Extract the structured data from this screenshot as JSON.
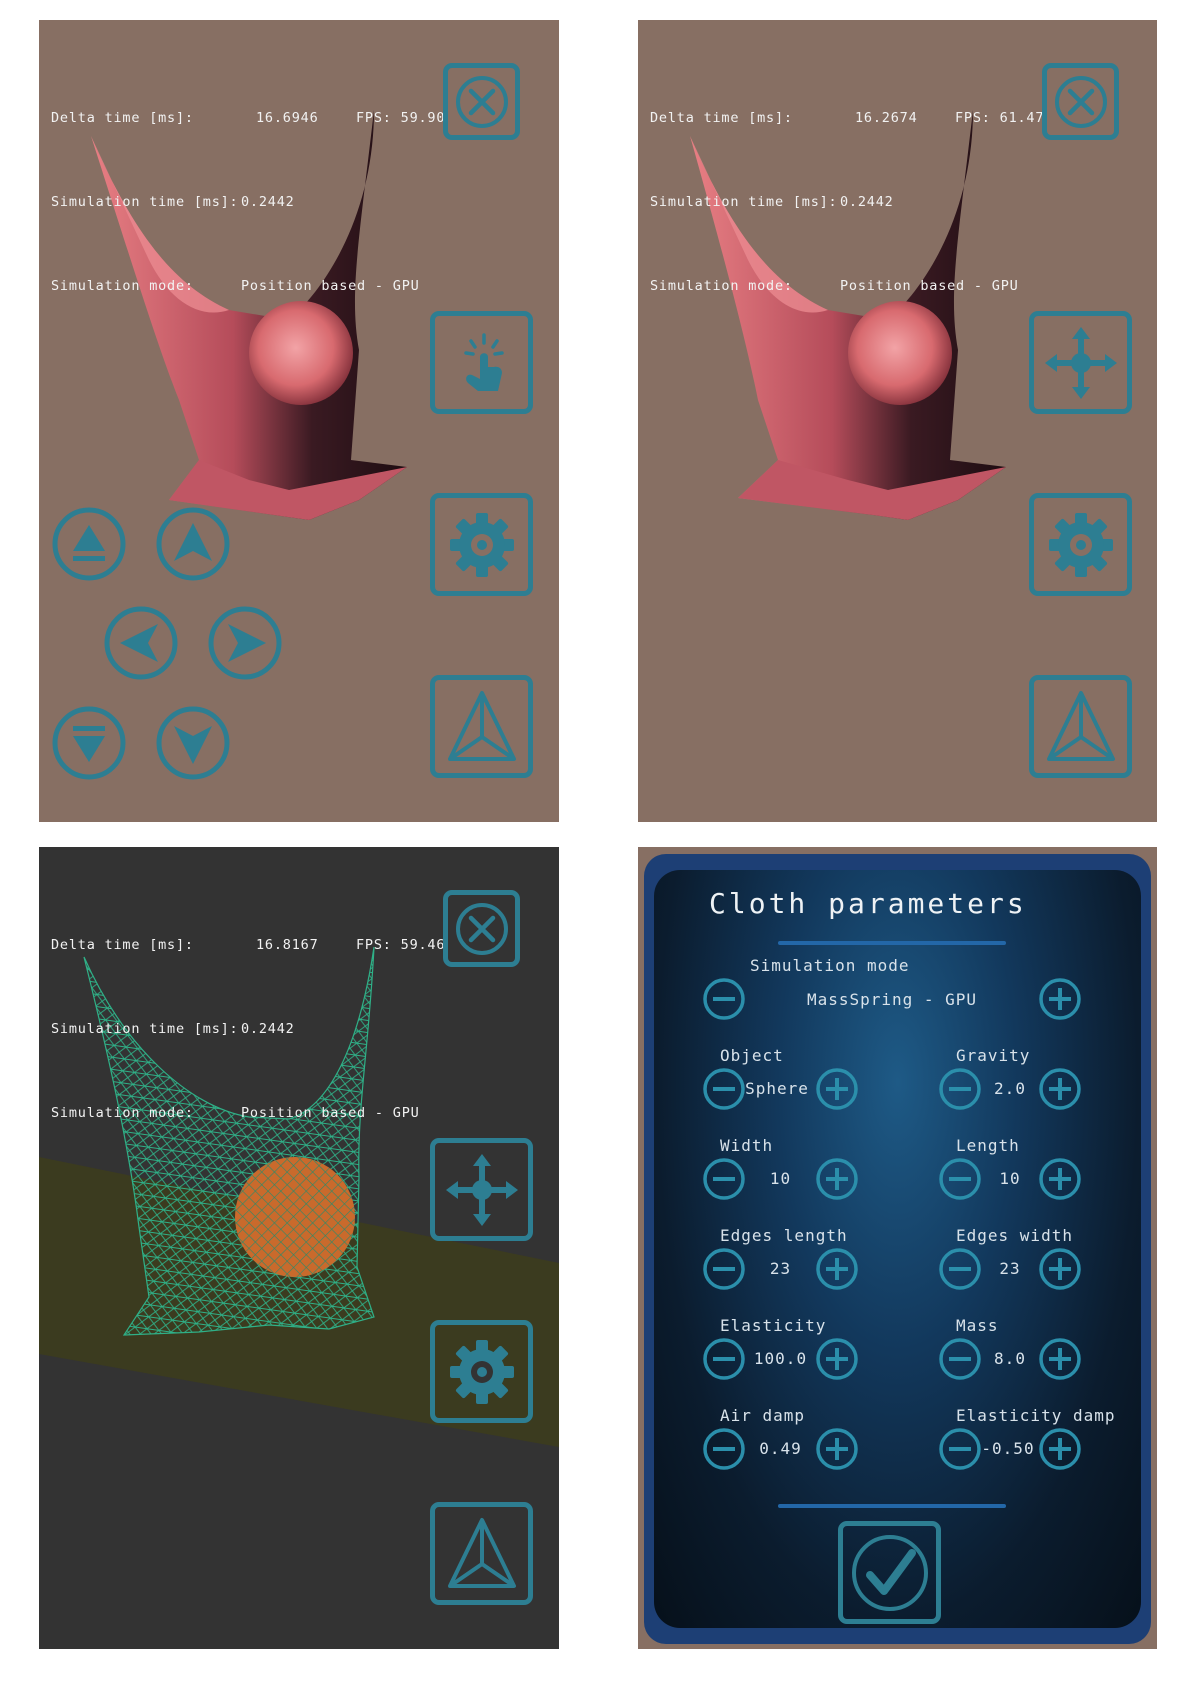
{
  "screens": [
    {
      "hud": {
        "delta_label": "Delta time [ms]:",
        "delta_value": "16.6946",
        "fps": "FPS: 59.90",
        "sim_time_label": "Simulation time [ms]:",
        "sim_time_value": "0.2442",
        "mode_label": "Simulation mode:",
        "mode_value": "Position based - GPU"
      },
      "render": "shaded",
      "buttons": [
        "close-icon",
        "touch-icon",
        "gear-icon",
        "wireframe-icon"
      ],
      "nav_pad": [
        "eject-up-icon",
        "arrow-up-icon",
        "arrow-left-icon",
        "arrow-right-icon",
        "eject-down-icon",
        "arrow-down-icon"
      ]
    },
    {
      "hud": {
        "delta_label": "Delta time [ms]:",
        "delta_value": "16.2674",
        "fps": "FPS: 61.47",
        "sim_time_label": "Simulation time [ms]:",
        "sim_time_value": "0.2442",
        "mode_label": "Simulation mode:",
        "mode_value": "Position based - GPU"
      },
      "render": "shaded",
      "buttons": [
        "close-icon",
        "move-icon",
        "gear-icon",
        "wireframe-icon"
      ]
    },
    {
      "hud": {
        "delta_label": "Delta time [ms]:",
        "delta_value": "16.8167",
        "fps": "FPS: 59.46",
        "sim_time_label": "Simulation time [ms]:",
        "sim_time_value": "0.2442",
        "mode_label": "Simulation mode:",
        "mode_value": "Position based - GPU"
      },
      "render": "wireframe",
      "buttons": [
        "close-icon",
        "move-icon",
        "gear-icon",
        "wireframe-icon"
      ]
    }
  ],
  "dialog": {
    "title": "Cloth parameters",
    "simulation_mode": {
      "label": "Simulation mode",
      "value": "MassSpring - GPU"
    },
    "params": {
      "object": {
        "label": "Object",
        "value": "Sphere"
      },
      "gravity": {
        "label": "Gravity",
        "value": "2.0"
      },
      "width": {
        "label": "Width",
        "value": "10"
      },
      "length": {
        "label": "Length",
        "value": "10"
      },
      "edges_length": {
        "label": "Edges length",
        "value": "23"
      },
      "edges_width": {
        "label": "Edges width",
        "value": "23"
      },
      "elasticity": {
        "label": "Elasticity",
        "value": "100.0"
      },
      "mass": {
        "label": "Mass",
        "value": "8.0"
      },
      "air_damp": {
        "label": "Air damp",
        "value": "0.49"
      },
      "elasticity_damp": {
        "label": "Elasticity damp",
        "value": "-0.50"
      }
    },
    "confirm_icon": "checkmark-icon"
  },
  "colors": {
    "viewport_background": "#876f63",
    "wireframe_background": "#333333",
    "ground_plane": "#3b3b1f",
    "cloth": "#d86a6a",
    "wire": "#2fb087",
    "sphere_wire": "#c96a2c",
    "icon_accent": "#2d7e92",
    "dialog_frame": "#1d3f75"
  }
}
